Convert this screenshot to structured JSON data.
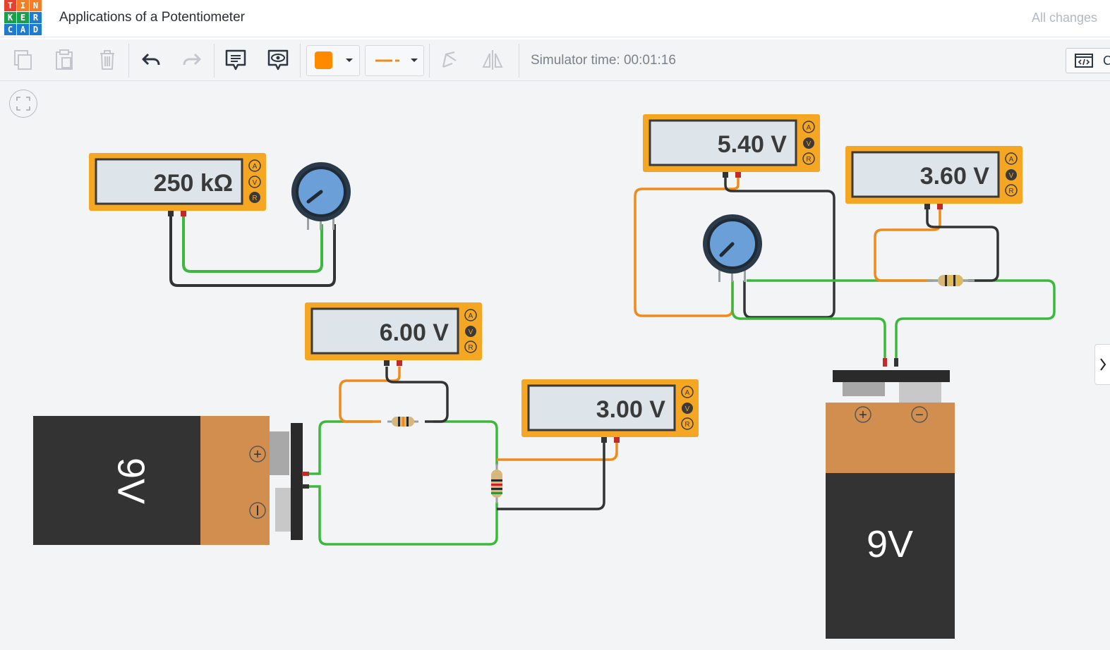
{
  "app": {
    "logo_letters": [
      "T",
      "I",
      "N",
      "K",
      "E",
      "R",
      "C",
      "A",
      "D"
    ],
    "title": "Applications of a Potentiometer",
    "save_status": "All changes"
  },
  "toolbar": {
    "buttons": [
      "copy-icon",
      "paste-icon",
      "delete-icon",
      "undo-icon",
      "redo-icon",
      "notes-icon",
      "visibility-icon"
    ],
    "wire_color": "#ff8a00",
    "simulator_time": "Simulator time: 00:01:16",
    "code_label": "C"
  },
  "circuit": {
    "multimeters": [
      {
        "reading": "250 kΩ",
        "modes": [
          "A",
          "V",
          "R"
        ],
        "active_mode": "R"
      },
      {
        "reading": "5.40 V",
        "modes": [
          "A",
          "V",
          "R"
        ],
        "active_mode": "V"
      },
      {
        "reading": "3.60 V",
        "modes": [
          "A",
          "V",
          "R"
        ],
        "active_mode": "V"
      },
      {
        "reading": "6.00 V",
        "modes": [
          "A",
          "V",
          "R"
        ],
        "active_mode": "V"
      },
      {
        "reading": "3.00 V",
        "modes": [
          "A",
          "V",
          "R"
        ],
        "active_mode": "V"
      }
    ],
    "batteries": [
      {
        "label": "9V",
        "plus": "+",
        "minus": "−"
      },
      {
        "label": "9V",
        "plus": "+",
        "minus": "−"
      }
    ]
  },
  "colors": {
    "meter_body": "#f5a623",
    "meter_screen": "#dde5ea",
    "wire_green": "#3cb83c",
    "wire_black": "#333333",
    "wire_orange": "#f08a1a",
    "battery_dark": "#333333",
    "battery_copper": "#d28e4e",
    "knob_blue": "#6a9fd8"
  }
}
